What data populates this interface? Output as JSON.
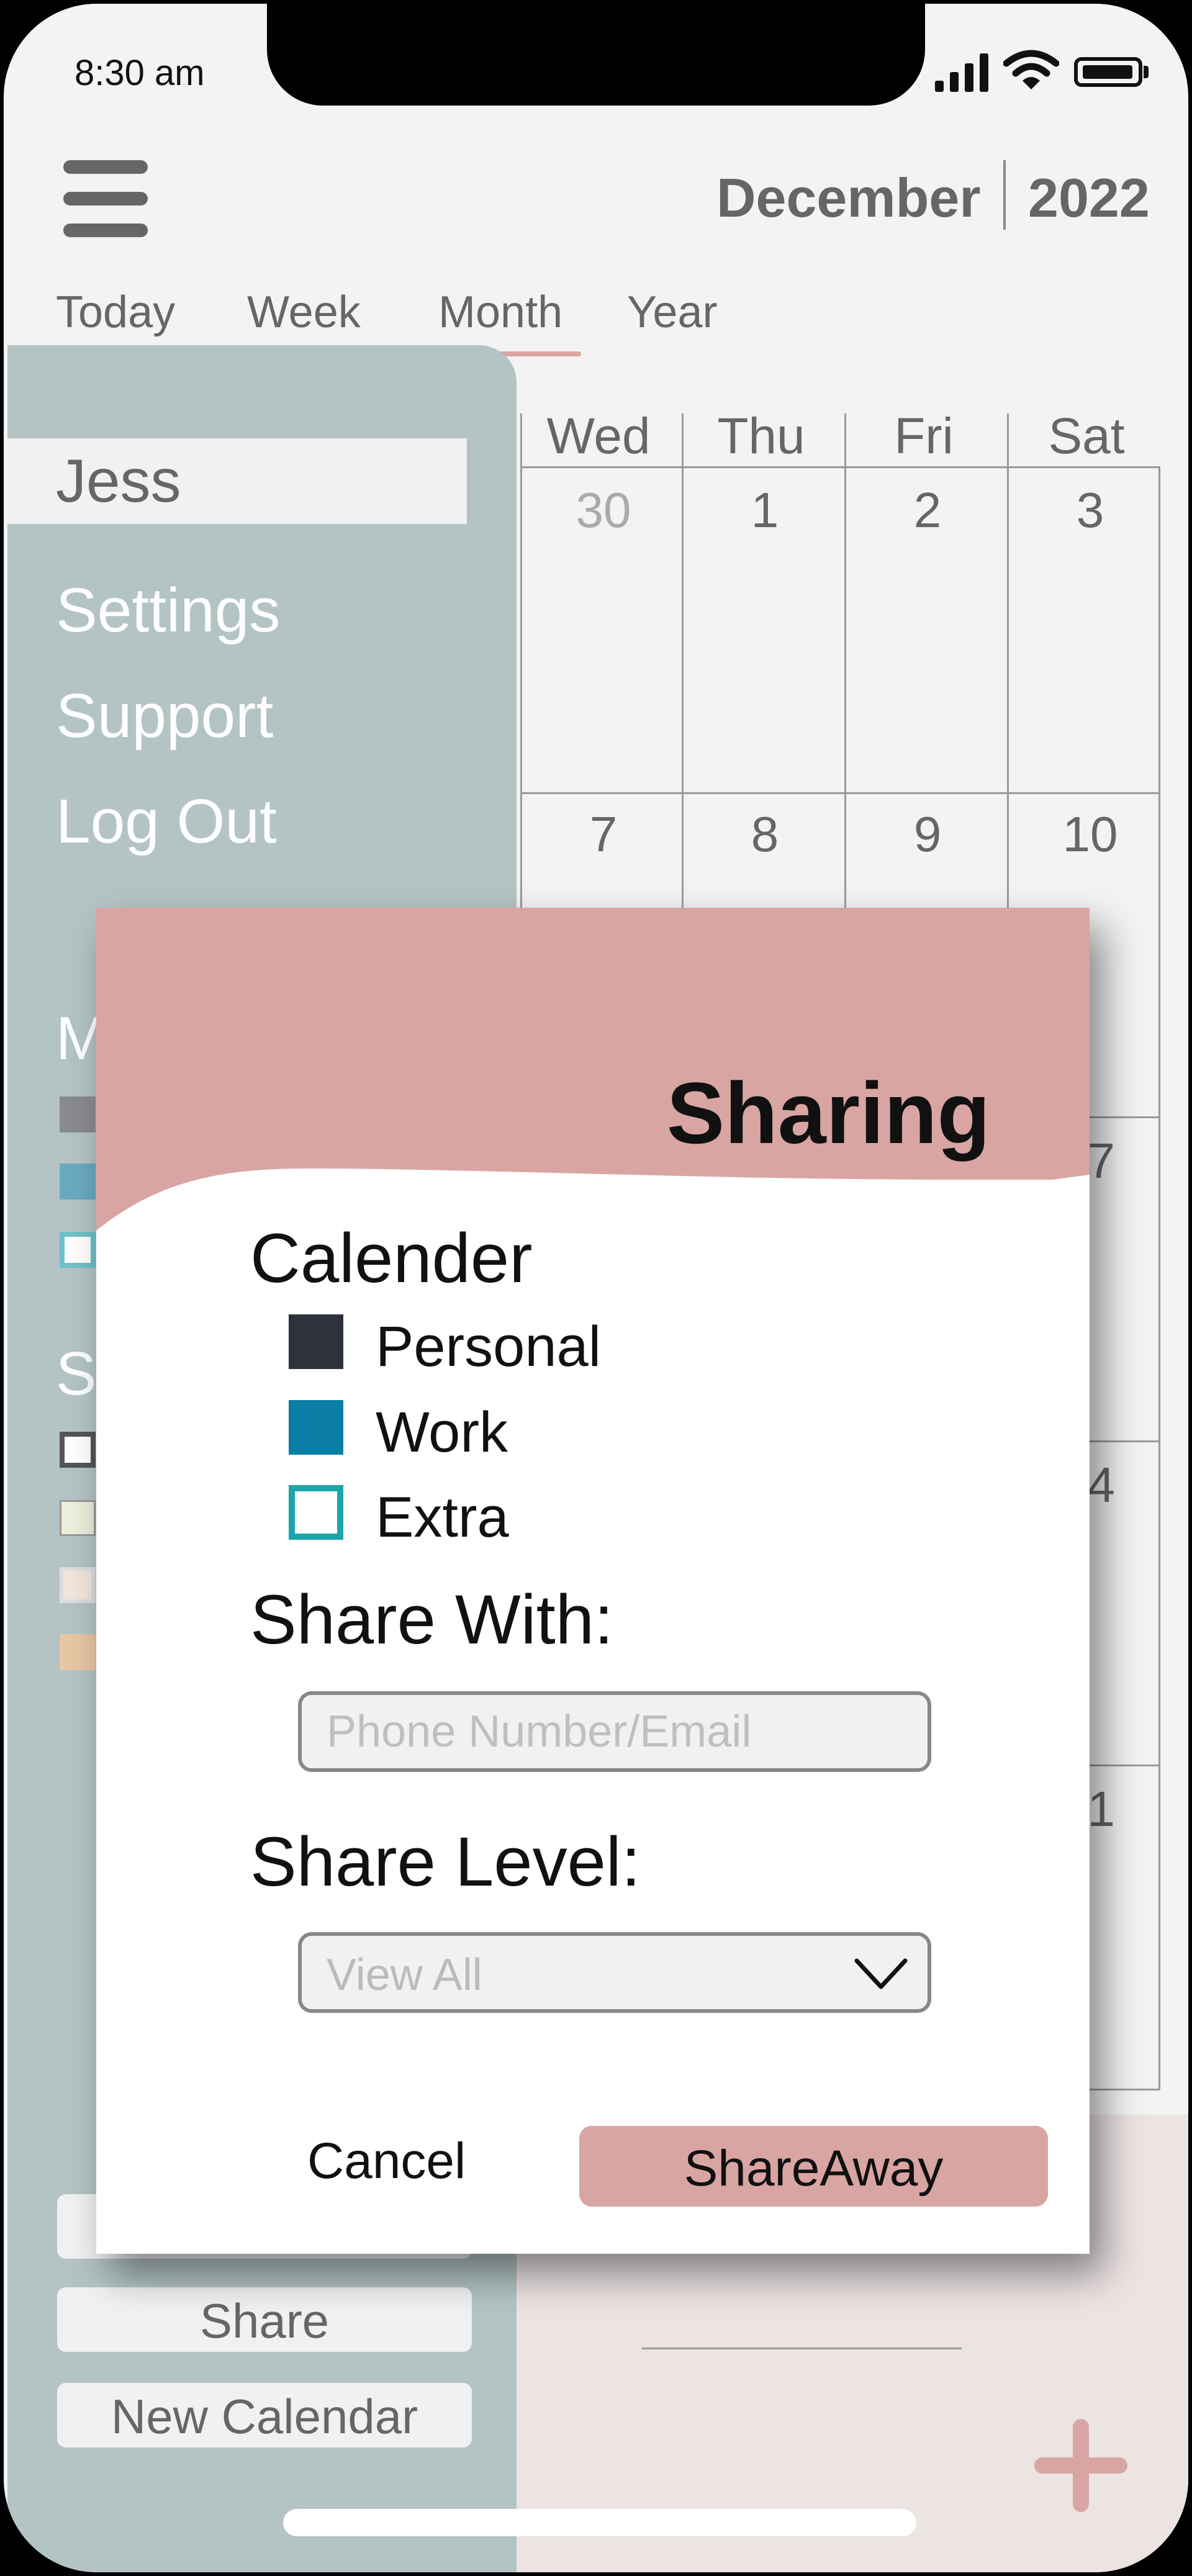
{
  "status_bar": {
    "time": "8:30 am"
  },
  "header": {
    "month": "December",
    "year": "2022"
  },
  "tabs": [
    "Today",
    "Week",
    "Month",
    "Year"
  ],
  "calendar": {
    "day_headers": [
      "Wed",
      "Thu",
      "Fri",
      "Sat"
    ],
    "row1": [
      "30",
      "1",
      "2",
      "3"
    ],
    "row2": [
      "7",
      "8",
      "9",
      "10"
    ],
    "row3_partial": "7",
    "row4_partial": "4",
    "row5_partial": "1"
  },
  "sidebar": {
    "user": "Jess",
    "links": [
      "Settings",
      "Support",
      "Log Out"
    ],
    "section1_partial": "M",
    "section2_partial": "Sl",
    "buttons": [
      "Share",
      "New Calendar"
    ]
  },
  "dialog": {
    "title": "Sharing",
    "calendar_label": "Calender",
    "calendars": [
      {
        "label": "Personal",
        "color": "#2e323d"
      },
      {
        "label": "Work",
        "color": "#0b7ea6"
      },
      {
        "label": "Extra",
        "color": "#1aa5aa"
      }
    ],
    "share_with_label": "Share With:",
    "share_with_placeholder": "Phone Number/Email",
    "share_level_label": "Share Level:",
    "share_level_value": "View All",
    "cancel_label": "Cancel",
    "share_label": "ShareAway"
  },
  "colors": {
    "accent_pink": "#d9a5a2",
    "sidebar_teal": "#b4c4c4",
    "screen_bg": "#f3f3f3"
  }
}
